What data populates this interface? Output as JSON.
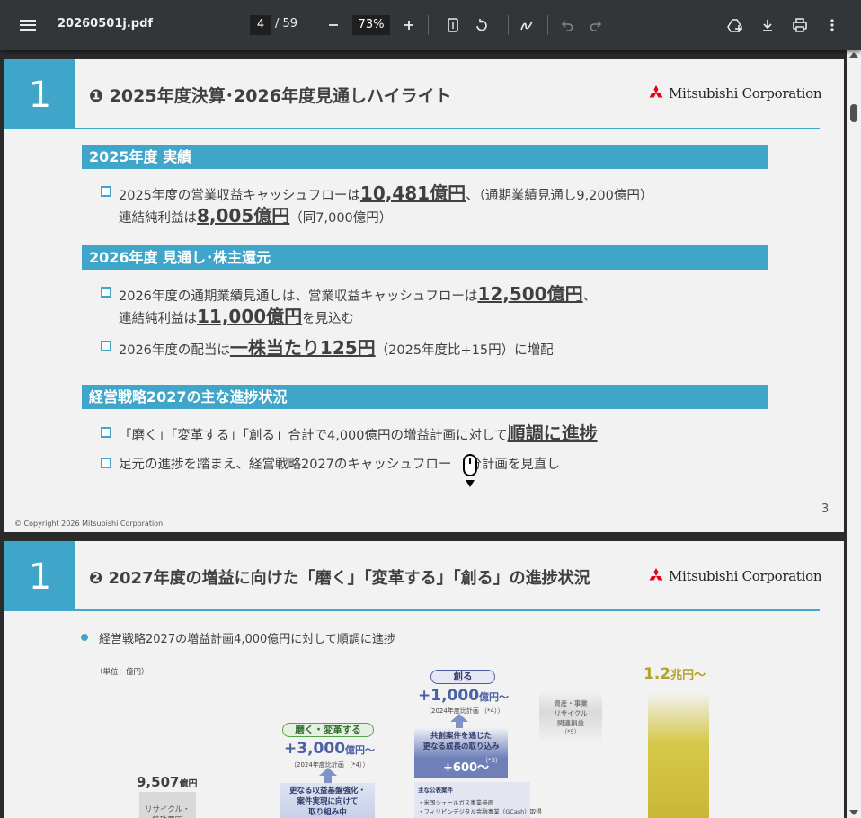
{
  "toolbar": {
    "file_name": "20260501j.pdf",
    "current_page": "4",
    "total_pages": "/ 59",
    "zoom": "73%"
  },
  "page1": {
    "number": "1",
    "title": "❶ 2025年度決算･2026年度見通しハイライト",
    "logo_text": "Mitsubishi Corporation",
    "sections": [
      {
        "heading": "2025年度 実績",
        "bullets": [
          {
            "line1_pre": "2025年度の営業収益キャッシュフローは",
            "line1_em": "10,481億円",
            "line1_post": "、（通期業績見通し9,200億円）",
            "line2_pre": "連結純利益は",
            "line2_em": "8,005億円",
            "line2_post": "（同7,000億円）"
          }
        ]
      },
      {
        "heading": "2026年度 見通し･株主還元",
        "bullets": [
          {
            "line1_pre": "2026年度の通期業績見通しは、営業収益キャッシュフローは",
            "line1_em": "12,500億円",
            "line1_post": "、",
            "line2_pre": "連結純利益は",
            "line2_em": "11,000億円",
            "line2_post": "を見込む"
          },
          {
            "line1_pre": "2026年度の配当は",
            "line1_em": "一株当たり125円",
            "line1_post": "（2025年度比+15円）に増配"
          }
        ]
      },
      {
        "heading": "経営戦略2027の主な進捗状況",
        "bullets": [
          {
            "line1_pre": "「磨く」「変革する」「創る」合計で4,000億円の増益計画に対して",
            "line1_em": "順調に進捗",
            "line1_post": ""
          },
          {
            "line1_pre": "足元の進捗を踏まえ、経営戦略2027のキャッシュフロー",
            "line1_post": "分計画を見直し"
          }
        ]
      }
    ],
    "copyright": "© Copyright 2026 Mitsubishi Corporation",
    "page_number": "3"
  },
  "page2": {
    "number": "1",
    "title": "❷ 2027年度の増益に向けた「磨く」「変革する」「創る」の進捗状況",
    "logo_text": "Mitsubishi Corporation",
    "bullet": "経営戦略2027の増益計画4,000億円に対して順調に進捗",
    "unit": "（単位：億円）",
    "base_value": "9,507",
    "base_unit": "億円",
    "base_label": "リサイクル・\n特殊要因",
    "migaku": {
      "pill": "磨く・変革する",
      "value": "+3,000",
      "unit": "億円～",
      "note": "（2024年度比計画 （*4））",
      "box": "更なる収益基盤強化・\n案件実現に向けて\n取り組み中"
    },
    "tsukuru": {
      "pill": "創る",
      "value": "+1,000",
      "unit": "億円～",
      "note": "（2024年度比計画 （*4））",
      "box_title": "共創案件を通じた\n更なる成長の取り込み",
      "box_value": "+600～",
      "box_note": "（*3）",
      "cases_title": "主な公表案件",
      "cases": [
        "・米国シェールガス事業参画",
        "・フィリピンデジタル金融事業（GCash）取得"
      ]
    },
    "asset": {
      "label": "資産・事業\nリサイクル\n関連損益",
      "note": "（*5）"
    },
    "target": {
      "value": "1.2",
      "unit": "兆円～"
    }
  }
}
